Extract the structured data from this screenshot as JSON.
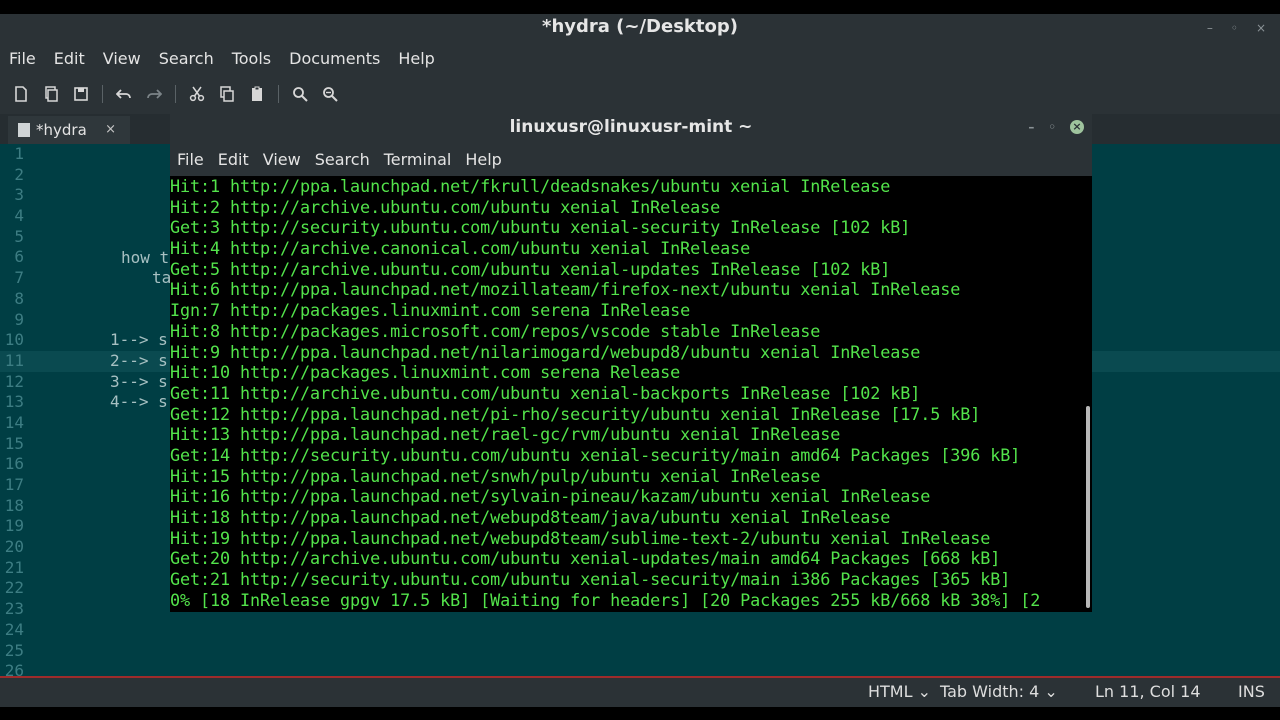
{
  "gedit": {
    "title": "*hydra (~/Desktop)",
    "window_controls": [
      "–",
      "◦",
      "×"
    ],
    "menu": [
      "File",
      "Edit",
      "View",
      "Search",
      "Tools",
      "Documents",
      "Help"
    ],
    "toolbar_icons": [
      "new-document-icon",
      "open-icon",
      "save-icon",
      "undo-icon",
      "redo-icon",
      "cut-icon",
      "copy-icon",
      "paste-icon",
      "find-icon",
      "find-replace-icon"
    ],
    "tab": {
      "label": "*hydra",
      "close": "×"
    },
    "line_numbers": [
      "1",
      "2",
      "3",
      "4",
      "5",
      "6",
      "7",
      "8",
      "9",
      "10",
      "11",
      "12",
      "13",
      "14",
      "15",
      "16",
      "17",
      "18",
      "19",
      "20",
      "21",
      "22",
      "23",
      "24",
      "25",
      "26"
    ],
    "code": {
      "line6": "how t",
      "line7": "ta",
      "line10": "1--> s",
      "line11": "2--> s",
      "line12": "3--> s",
      "line13": "4--> s"
    },
    "status": {
      "language": "HTML",
      "tab_width": "Tab Width:  4",
      "position": "Ln 11, Col 14",
      "mode": "INS"
    }
  },
  "terminal": {
    "title": "linuxusr@linuxusr-mint ~",
    "menu": [
      "File",
      "Edit",
      "View",
      "Search",
      "Terminal",
      "Help"
    ],
    "lines": [
      "Hit:1 http://ppa.launchpad.net/fkrull/deadsnakes/ubuntu xenial InRelease",
      "Hit:2 http://archive.ubuntu.com/ubuntu xenial InRelease",
      "Get:3 http://security.ubuntu.com/ubuntu xenial-security InRelease [102 kB]",
      "Hit:4 http://archive.canonical.com/ubuntu xenial InRelease",
      "Get:5 http://archive.ubuntu.com/ubuntu xenial-updates InRelease [102 kB]",
      "Hit:6 http://ppa.launchpad.net/mozillateam/firefox-next/ubuntu xenial InRelease",
      "Ign:7 http://packages.linuxmint.com serena InRelease",
      "Hit:8 http://packages.microsoft.com/repos/vscode stable InRelease",
      "Hit:9 http://ppa.launchpad.net/nilarimogard/webupd8/ubuntu xenial InRelease",
      "Hit:10 http://packages.linuxmint.com serena Release",
      "Get:11 http://archive.ubuntu.com/ubuntu xenial-backports InRelease [102 kB]",
      "Get:12 http://ppa.launchpad.net/pi-rho/security/ubuntu xenial InRelease [17.5 kB]",
      "Hit:13 http://ppa.launchpad.net/rael-gc/rvm/ubuntu xenial InRelease",
      "Get:14 http://security.ubuntu.com/ubuntu xenial-security/main amd64 Packages [396 kB]",
      "Hit:15 http://ppa.launchpad.net/snwh/pulp/ubuntu xenial InRelease",
      "Hit:16 http://ppa.launchpad.net/sylvain-pineau/kazam/ubuntu xenial InRelease",
      "Hit:18 http://ppa.launchpad.net/webupd8team/java/ubuntu xenial InRelease",
      "Hit:19 http://ppa.launchpad.net/webupd8team/sublime-text-2/ubuntu xenial InRelease",
      "Get:20 http://archive.ubuntu.com/ubuntu xenial-updates/main amd64 Packages [668 kB]",
      "Get:21 http://security.ubuntu.com/ubuntu xenial-security/main i386 Packages [365 kB]",
      "0% [18 InRelease gpgv 17.5 kB] [Waiting for headers] [20 Packages 255 kB/668 kB 38%] [2"
    ]
  },
  "colors": {
    "editor_bg": "#003e44",
    "terminal_text": "#53e34b",
    "chrome_bg": "#2b3236"
  }
}
